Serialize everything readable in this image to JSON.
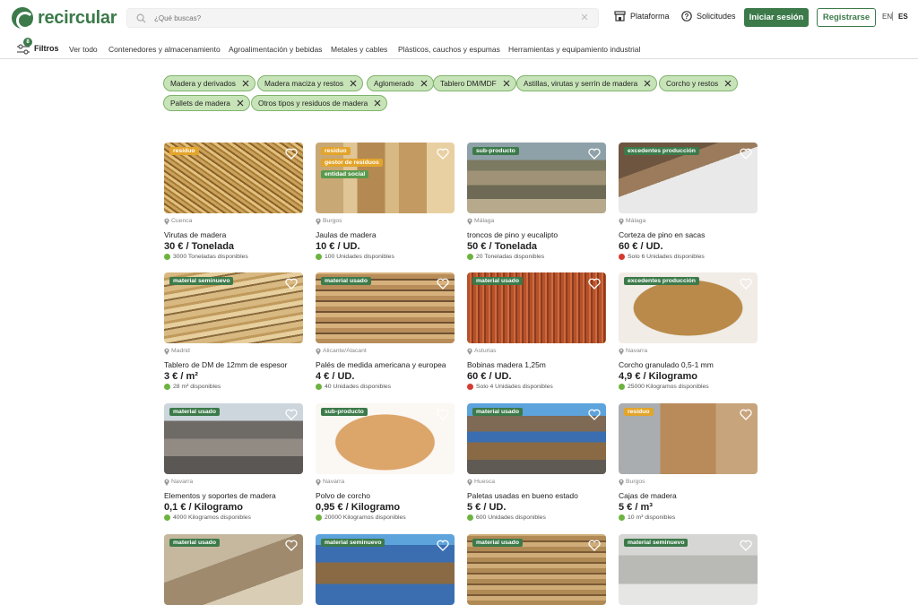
{
  "header": {
    "logo_text": "recircular",
    "search_placeholder": "¿Qué buscas?",
    "nav_plataforma": "Plataforma",
    "nav_solicitudes": "Solicitudes",
    "login_label": "Iniciar sesión",
    "register_label": "Registrarse",
    "lang_en": "EN",
    "lang_es": "ES"
  },
  "categories": {
    "filter_count": "8",
    "filters_label": "Filtros",
    "items": [
      "Ver todo",
      "Contenedores y almacenamiento",
      "Agroalimentación y bebidas",
      "Metales y cables",
      "Plásticos, cauchos y espumas",
      "Herramientas y equipamiento industrial"
    ]
  },
  "chips": [
    "Madera y derivados",
    "Madera maciza y restos",
    "Aglomerado",
    "Tablero DM/MDF",
    "Astillas, virutas y serrín de madera",
    "Corcho y restos",
    "Pallets de madera",
    "Otros tipos y residuos de madera"
  ],
  "products": [
    {
      "tags": [
        "residuo"
      ],
      "location": "Cuenca",
      "title": "Virutas de madera",
      "price": "30 € / Tonelada",
      "availability": "3000 Toneladas disponibles",
      "status": "green"
    },
    {
      "tags": [
        "residuo",
        "gestor de residuos",
        "entidad social"
      ],
      "location": "Burgos",
      "title": "Jaulas de madera",
      "price": "10 € / UD.",
      "availability": "100 Unidades disponibles",
      "status": "green"
    },
    {
      "tags": [
        "sub-producto"
      ],
      "location": "Málaga",
      "title": "troncos de pino y eucalipto",
      "price": "50 € / Tonelada",
      "availability": "20 Toneladas disponibles",
      "status": "green"
    },
    {
      "tags": [
        "excedentes producción"
      ],
      "location": "Málaga",
      "title": "Corteza de pino en sacas",
      "price": "60 € / UD.",
      "availability": "Solo 6 Unidades disponibles",
      "status": "red"
    },
    {
      "tags": [
        "material seminuevo"
      ],
      "location": "Madrid",
      "title": "Tablero de DM de 12mm de espesor",
      "price": "3 € / m²",
      "availability": "28 m² disponibles",
      "status": "green"
    },
    {
      "tags": [
        "material usado"
      ],
      "location": "Alicante/Alacant",
      "title": "Palés de medida americana y europea",
      "price": "4 € / UD.",
      "availability": "40 Unidades disponibles",
      "status": "green"
    },
    {
      "tags": [
        "material usado"
      ],
      "location": "Asturias",
      "title": "Bobinas madera 1,25m",
      "price": "60 € / UD.",
      "availability": "Solo 4 Unidades disponibles",
      "status": "red"
    },
    {
      "tags": [
        "excedentes producción"
      ],
      "location": "Navarra",
      "title": "Corcho granulado 0,5-1 mm",
      "price": "4,9 € / Kilogramo",
      "availability": "25000 Kilogramos disponibles",
      "status": "green"
    },
    {
      "tags": [
        "material usado"
      ],
      "location": "Navarra",
      "title": "Elementos y soportes de madera",
      "price": "0,1 € / Kilogramo",
      "availability": "4000 Kilogramos disponibles",
      "status": "green"
    },
    {
      "tags": [
        "sub-producto"
      ],
      "location": "Navarra",
      "title": "Polvo de corcho",
      "price": "0,95 € / Kilogramo",
      "availability": "20000 Kilogramos disponibles",
      "status": "green"
    },
    {
      "tags": [
        "material usado"
      ],
      "location": "Huesca",
      "title": "Paletas usadas en bueno estado",
      "price": "5 € / UD.",
      "availability": "600 Unidades disponibles",
      "status": "green"
    },
    {
      "tags": [
        "residuo"
      ],
      "location": "Burgos",
      "title": "Cajas de madera",
      "price": "5 € / m³",
      "availability": "10 m³ disponibles",
      "status": "green"
    },
    {
      "tags": [
        "material usado"
      ]
    },
    {
      "tags": [
        "material seminuevo"
      ]
    },
    {
      "tags": [
        "material usado"
      ]
    },
    {
      "tags": [
        "material seminuevo"
      ]
    }
  ]
}
